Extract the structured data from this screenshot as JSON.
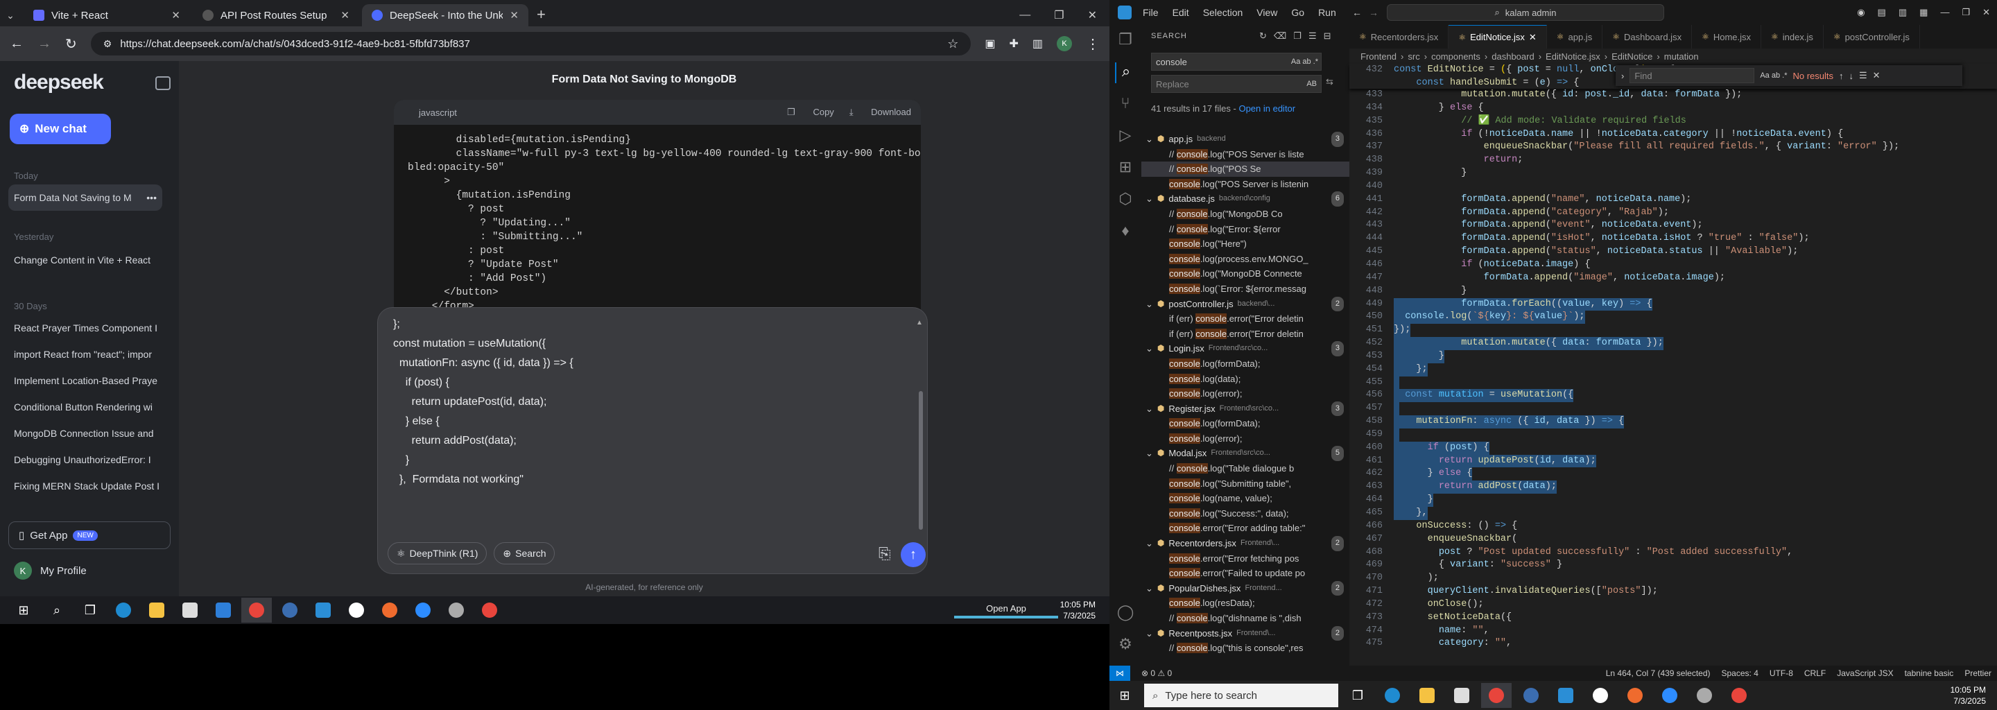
{
  "browser": {
    "tabs": [
      {
        "title": "Vite + React",
        "color": "#646cff"
      },
      {
        "title": "API Post Routes Setup",
        "color": "#444"
      },
      {
        "title": "DeepSeek - Into the Unknown",
        "color": "#4d6bfe"
      }
    ],
    "url": "https://chat.deepseek.com/a/chat/s/043dced3-91f2-4ae9-bc81-5fbfd73bf837"
  },
  "deepseek": {
    "logo": "deepseek",
    "new_chat": "New chat",
    "today": "Today",
    "yesterday": "Yesterday",
    "days30": "30 Days",
    "chats_today": [
      "Form Data Not Saving to M"
    ],
    "chats_yesterday": [
      "Change Content in Vite + React"
    ],
    "chats_30": [
      "React Prayer Times Component I",
      "import React from \"react\"; impor",
      "Implement Location-Based Praye",
      "Conditional Button Rendering wi",
      "MongoDB Connection Issue and",
      "Debugging UnauthorizedError: I",
      "Fixing MERN Stack Update Post I"
    ],
    "get_app": "Get App",
    "new_badge": "NEW",
    "profile": "My Profile",
    "chat_title": "Form Data Not Saving to MongoDB",
    "code_lang": "javascript",
    "copy": "Copy",
    "download": "Download",
    "code_lines": [
      "        disabled={mutation.isPending}",
      "        className=\"w-full py-3 text-lg bg-yellow-400 rounded-lg text-gray-900 font-bold disa",
      "bled:opacity-50\"",
      "      >",
      "        {mutation.isPending",
      "          ? post",
      "            ? \"Updating...\"",
      "            : \"Submitting...\"",
      "          : post",
      "          ? \"Update Post\"",
      "          : \"Add Post\")",
      "      </button>",
      "    </form>"
    ],
    "input_lines": [
      "};",
      "",
      "const mutation = useMutation({",
      "",
      "  mutationFn: async ({ id, data }) => {",
      "",
      "    if (post) {",
      "      return updatePost(id, data);",
      "    } else {",
      "      return addPost(data);",
      "    }",
      "  },  Formdata not working\""
    ],
    "deepthink": "DeepThink (R1)",
    "search": "Search",
    "disclaimer": "AI-generated, for reference only"
  },
  "taskbar1": {
    "open_app": "Open App",
    "time": "10:05 PM",
    "date": "7/3/2025"
  },
  "vscode": {
    "menu": [
      "File",
      "Edit",
      "Selection",
      "View",
      "Go",
      "Run"
    ],
    "command_center": "kalam admin",
    "search_label": "SEARCH",
    "search_value": "console",
    "replace_placeholder": "Replace",
    "results_info": "41 results in 17 files - ",
    "open_in_editor": "Open in editor",
    "tabs": [
      "Recentorders.jsx",
      "EditNotice.jsx",
      "app.js",
      "Dashboard.jsx",
      "Home.jsx",
      "index.js",
      "postController.js"
    ],
    "breadcrumb": [
      "Frontend",
      "src",
      "components",
      "dashboard",
      "EditNotice.jsx",
      "EditNotice",
      "mutation"
    ],
    "find_placeholder": "Find",
    "find_result": "No results",
    "results": [
      {
        "t": "file",
        "name": "app.js",
        "path": "backend",
        "count": "3"
      },
      {
        "t": "m",
        "pre": "// ",
        "hl": "console",
        "post": ".log(\"POS Server is liste"
      },
      {
        "t": "m",
        "pre": "// ",
        "hl": "console",
        "post": ".log(\"POS Se",
        "sel": true
      },
      {
        "t": "m",
        "pre": "",
        "hl": "console",
        "post": ".log(\"POS Server is listenin"
      },
      {
        "t": "file",
        "name": "database.js",
        "path": "backend\\config",
        "count": "6"
      },
      {
        "t": "m",
        "pre": "// ",
        "hl": "console",
        "post": ".log(\"MongoDB Co"
      },
      {
        "t": "m",
        "pre": "// ",
        "hl": "console",
        "post": ".log(\"Error: ${error"
      },
      {
        "t": "m",
        "pre": "",
        "hl": "console",
        "post": ".log(\"Here\")"
      },
      {
        "t": "m",
        "pre": "",
        "hl": "console",
        "post": ".log(process.env.MONGO_"
      },
      {
        "t": "m",
        "pre": "",
        "hl": "console",
        "post": ".log(\"MongoDB Connecte"
      },
      {
        "t": "m",
        "pre": "",
        "hl": "console",
        "post": ".log(`Error: ${error.messag"
      },
      {
        "t": "file",
        "name": "postController.js",
        "path": "backend\\...",
        "count": "2"
      },
      {
        "t": "m",
        "pre": "if (err) ",
        "hl": "console",
        "post": ".error(\"Error deletin"
      },
      {
        "t": "m",
        "pre": "if (err) ",
        "hl": "console",
        "post": ".error(\"Error deletin"
      },
      {
        "t": "file",
        "name": "Login.jsx",
        "path": "Frontend\\src\\co...",
        "count": "3"
      },
      {
        "t": "m",
        "pre": "",
        "hl": "console",
        "post": ".log(formData);"
      },
      {
        "t": "m",
        "pre": "",
        "hl": "console",
        "post": ".log(data);"
      },
      {
        "t": "m",
        "pre": "",
        "hl": "console",
        "post": ".log(error);"
      },
      {
        "t": "file",
        "name": "Register.jsx",
        "path": "Frontend\\src\\co...",
        "count": "3"
      },
      {
        "t": "m",
        "pre": "",
        "hl": "console",
        "post": ".log(formData);"
      },
      {
        "t": "m",
        "pre": "",
        "hl": "console",
        "post": ".log(error);"
      },
      {
        "t": "file",
        "name": "Modal.jsx",
        "path": "Frontend\\src\\co...",
        "count": "5"
      },
      {
        "t": "m",
        "pre": "// ",
        "hl": "console",
        "post": ".log(\"Table dialogue b"
      },
      {
        "t": "m",
        "pre": "",
        "hl": "console",
        "post": ".log(\"Submitting table\","
      },
      {
        "t": "m",
        "pre": "",
        "hl": "console",
        "post": ".log(name, value);"
      },
      {
        "t": "m",
        "pre": "",
        "hl": "console",
        "post": ".log(\"Success:\", data);"
      },
      {
        "t": "m",
        "pre": "",
        "hl": "console",
        "post": ".error(\"Error adding table:\""
      },
      {
        "t": "file",
        "name": "Recentorders.jsx",
        "path": "Frontend\\...",
        "count": "2"
      },
      {
        "t": "m",
        "pre": "",
        "hl": "console",
        "post": ".error(\"Error fetching pos"
      },
      {
        "t": "m",
        "pre": "",
        "hl": "console",
        "post": ".error(\"Failed to update po"
      },
      {
        "t": "file",
        "name": "PopularDishes.jsx",
        "path": "Frontend...",
        "count": "2"
      },
      {
        "t": "m",
        "pre": "",
        "hl": "console",
        "post": ".log(resData);"
      },
      {
        "t": "m",
        "pre": "// ",
        "hl": "console",
        "post": ".log(\"dishname is \",dish"
      },
      {
        "t": "file",
        "name": "Recentposts.jsx",
        "path": "Frontend\\...",
        "count": "2"
      },
      {
        "t": "m",
        "pre": "// ",
        "hl": "console",
        "post": ".log(\"this is console\",res"
      }
    ],
    "status": {
      "errors": "0",
      "warnings": "0",
      "position": "Ln 464, Col 7 (439 selected)",
      "spaces": "Spaces: 4",
      "encoding": "UTF-8",
      "eol": "CRLF",
      "lang": "JavaScript JSX",
      "tabnine": "tabnine basic",
      "prettier": "Prettier"
    },
    "search_taskbar": "Type here to search",
    "time": "10:05 PM",
    "date": "7/3/2025"
  }
}
